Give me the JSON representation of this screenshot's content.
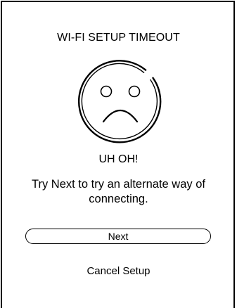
{
  "screen": {
    "title": "WI-FI SETUP TIMEOUT",
    "icon": "sad-face-icon",
    "heading": "UH OH!",
    "message": "Try Next to try an alternate way of connecting.",
    "next_label": "Next",
    "cancel_label": "Cancel Setup"
  },
  "colors": {
    "foreground": "#000000",
    "background": "#ffffff"
  }
}
